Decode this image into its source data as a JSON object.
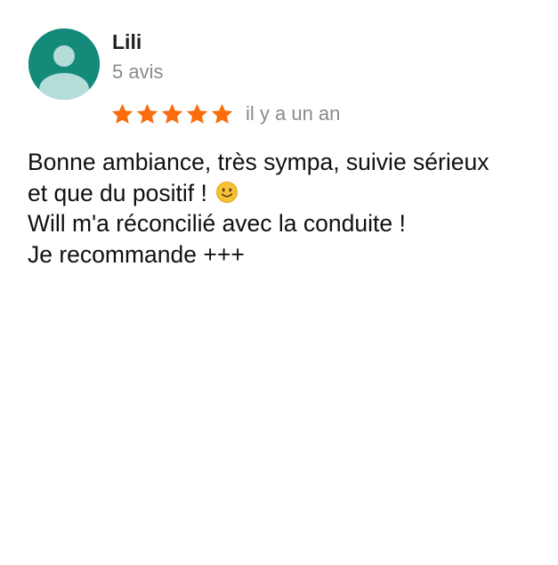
{
  "review": {
    "author": {
      "name": "Lili",
      "review_count": "5 avis",
      "avatar_icon": "default-user-avatar-icon",
      "avatar_color": "#138a7a"
    },
    "rating": {
      "value": 5,
      "max": 5,
      "star_color": "#f96d0c",
      "star_icon": "star-icon"
    },
    "time_ago": "il y a un an",
    "text_lines": [
      "Bonne ambiance, très sympa, suivie sérieux",
      "et que du positif !",
      "Will m'a réconcilié avec la conduite !",
      "Je recommande +++"
    ],
    "emoji": {
      "icon": "slightly-smiling-face-icon",
      "color": "#f7c136"
    }
  }
}
